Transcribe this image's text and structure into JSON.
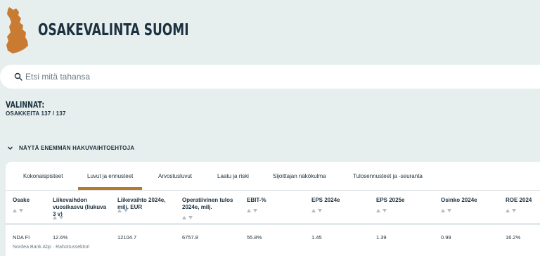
{
  "header": {
    "title": "OSAKEVALINTA SUOMI",
    "logo": "finland-map-icon"
  },
  "search": {
    "placeholder": "Etsi mitä tahansa",
    "value": "",
    "icon": "search-icon"
  },
  "selections": {
    "heading": "VALINNAT:",
    "count_text": "OSAKKEITA 137 / 137"
  },
  "more_options": {
    "label": "NÄYTÄ ENEMMÄN HAKUVAIHTOEHTOJA",
    "icon": "chevron-down-icon"
  },
  "tabs": [
    {
      "label": "Kokonaispisteet"
    },
    {
      "label": "Luvut ja ennusteet",
      "active": true
    },
    {
      "label": "Arvostusluvut"
    },
    {
      "label": "Laatu ja riski"
    },
    {
      "label": "Sijoittajan näkökulma"
    },
    {
      "label": "Tulosennusteet ja -seuranta"
    }
  ],
  "table": {
    "columns": [
      {
        "label": "Osake"
      },
      {
        "label": "Liikevaihdon vuosikasvu (liukuva 3 v)"
      },
      {
        "label": "Liikevaihto 2024e, milj. EUR"
      },
      {
        "label": "Operatiivinen tulos 2024e, milj."
      },
      {
        "label": "EBIT-%"
      },
      {
        "label": "EPS 2024e"
      },
      {
        "label": "EPS 2025e"
      },
      {
        "label": "Osinko 2024e"
      },
      {
        "label": "ROE 2024"
      }
    ],
    "rows": [
      {
        "cells": [
          "NDA FI",
          "12.6%",
          "12104.7",
          "6757.8",
          "55.8%",
          "1.45",
          "1.39",
          "0.99",
          "16.2%"
        ],
        "subtitle": "Nordea Bank Abp · Rahoitussektori"
      }
    ]
  },
  "colors": {
    "accent": "#b8782a",
    "logo": "#c97b32",
    "background": "#e6efee",
    "text": "#1d3140"
  }
}
